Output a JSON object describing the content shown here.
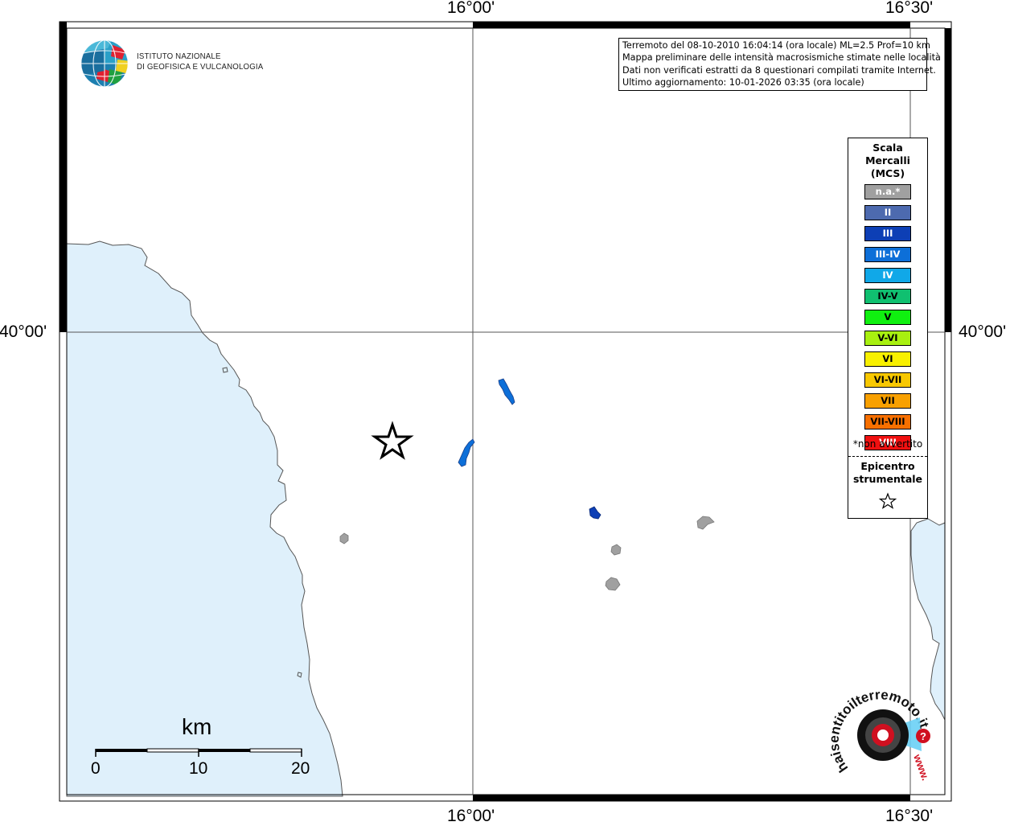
{
  "map": {
    "lon_labels": [
      "16°00'",
      "16°30'"
    ],
    "lat_labels": [
      "40°00'"
    ]
  },
  "institute": {
    "line1": "ISTITUTO NAZIONALE",
    "line2": "DI GEOFISICA E VULCANOLOGIA"
  },
  "info": {
    "line1": "Terremoto del 08-10-2010 16:04:14 (ora locale) ML=2.5 Prof=10 km",
    "line2": "Mappa preliminare delle intensità macrosismiche stimate nelle località",
    "line3": "Dati non verificati estratti da 8 questionari compilati tramite Internet.",
    "line4": "Ultimo aggiornamento: 10-01-2026 03:35 (ora locale)"
  },
  "legend": {
    "title_lines": [
      "Scala",
      "Mercalli",
      "(MCS)"
    ],
    "items": [
      {
        "label": "n.a.*",
        "color": "#a0a0a0",
        "text_color": "#ffffff"
      },
      {
        "label": "II",
        "color": "#4d6aaf",
        "text_color": "#ffffff"
      },
      {
        "label": "III",
        "color": "#0d3fb5",
        "text_color": "#ffffff"
      },
      {
        "label": "III-IV",
        "color": "#0d6fd8",
        "text_color": "#ffffff"
      },
      {
        "label": "IV",
        "color": "#10a8e8",
        "text_color": "#ffffff"
      },
      {
        "label": "IV-V",
        "color": "#10c070",
        "text_color": "#000000"
      },
      {
        "label": "V",
        "color": "#10f010",
        "text_color": "#000000"
      },
      {
        "label": "V-VI",
        "color": "#a8f010",
        "text_color": "#000000"
      },
      {
        "label": "VI",
        "color": "#f8f000",
        "text_color": "#000000"
      },
      {
        "label": "VI-VII",
        "color": "#f8c800",
        "text_color": "#000000"
      },
      {
        "label": "VII",
        "color": "#f8a000",
        "text_color": "#000000"
      },
      {
        "label": "VII-VIII",
        "color": "#f87000",
        "text_color": "#000000"
      },
      {
        "label": "VIII",
        "color": "#f01010",
        "text_color": "#ffffff"
      }
    ],
    "note": "*non avvertito",
    "epicenter_lines": [
      "Epicentro",
      "strumentale"
    ]
  },
  "scale_bar": {
    "title": "km",
    "labels": [
      "0",
      "10",
      "20"
    ]
  },
  "colors": {
    "sea": "#dff0fb",
    "na_locality": "#a0a0a0",
    "intensity_III": "#0d3fb5",
    "intensity_III_IV": "#0d6fd8"
  },
  "watermark": {
    "text": "haisentitoilterremoto.it",
    "site": "www."
  }
}
